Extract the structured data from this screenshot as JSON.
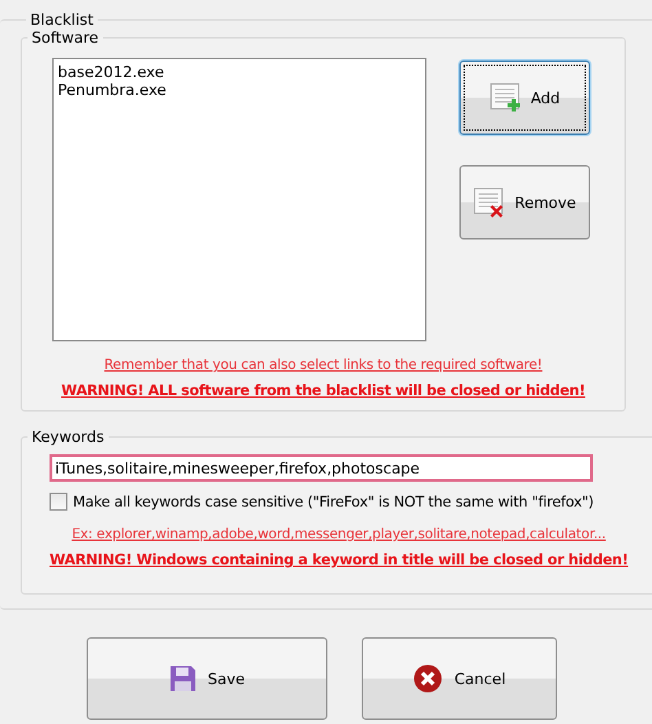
{
  "blacklist": {
    "title": "Blacklist",
    "software": {
      "title": "Software",
      "items": [
        "base2012.exe",
        "Penumbra.exe"
      ],
      "buttons": [
        {
          "kind": "add",
          "label": "Add",
          "focused": true
        },
        {
          "kind": "remove",
          "label": "Remove",
          "focused": false
        }
      ],
      "link": "Remember that you can also select links to the required software!",
      "warning": "WARNING! ALL software from the blacklist will be closed or hidden!"
    },
    "keywords": {
      "title": "Keywords",
      "value": "iTunes,solitaire,minesweeper,firefox,photoscape",
      "case_sensitive": {
        "label": "Make all keywords case sensitive (\"FireFox\" is NOT the same with \"firefox\")",
        "checked": false
      },
      "example": "Ex: explorer,winamp,adobe,word,messenger,player,solitare,notepad,calculator...",
      "warning": "WARNING! Windows containing a keyword in title will be closed or hidden!"
    }
  },
  "buttons": [
    {
      "kind": "save",
      "label": "Save"
    },
    {
      "kind": "cancel",
      "label": "Cancel"
    }
  ]
}
